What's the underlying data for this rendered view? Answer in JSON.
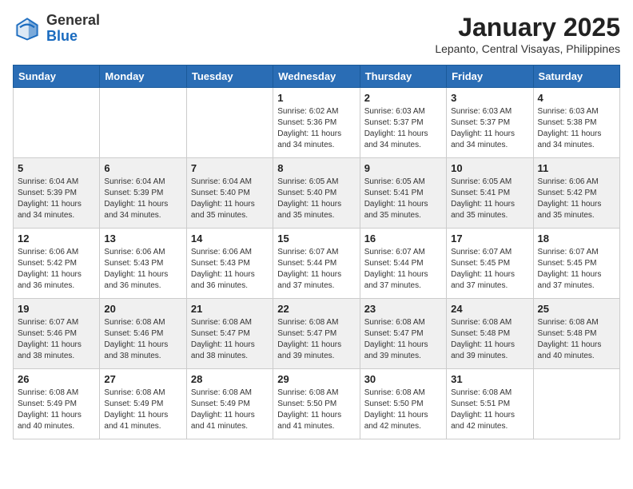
{
  "header": {
    "logo": {
      "general": "General",
      "blue": "Blue"
    },
    "title": "January 2025",
    "location": "Lepanto, Central Visayas, Philippines"
  },
  "weekdays": [
    "Sunday",
    "Monday",
    "Tuesday",
    "Wednesday",
    "Thursday",
    "Friday",
    "Saturday"
  ],
  "weeks": [
    [
      {
        "day": "",
        "info": ""
      },
      {
        "day": "",
        "info": ""
      },
      {
        "day": "",
        "info": ""
      },
      {
        "day": "1",
        "info": "Sunrise: 6:02 AM\nSunset: 5:36 PM\nDaylight: 11 hours\nand 34 minutes."
      },
      {
        "day": "2",
        "info": "Sunrise: 6:03 AM\nSunset: 5:37 PM\nDaylight: 11 hours\nand 34 minutes."
      },
      {
        "day": "3",
        "info": "Sunrise: 6:03 AM\nSunset: 5:37 PM\nDaylight: 11 hours\nand 34 minutes."
      },
      {
        "day": "4",
        "info": "Sunrise: 6:03 AM\nSunset: 5:38 PM\nDaylight: 11 hours\nand 34 minutes."
      }
    ],
    [
      {
        "day": "5",
        "info": "Sunrise: 6:04 AM\nSunset: 5:39 PM\nDaylight: 11 hours\nand 34 minutes."
      },
      {
        "day": "6",
        "info": "Sunrise: 6:04 AM\nSunset: 5:39 PM\nDaylight: 11 hours\nand 34 minutes."
      },
      {
        "day": "7",
        "info": "Sunrise: 6:04 AM\nSunset: 5:40 PM\nDaylight: 11 hours\nand 35 minutes."
      },
      {
        "day": "8",
        "info": "Sunrise: 6:05 AM\nSunset: 5:40 PM\nDaylight: 11 hours\nand 35 minutes."
      },
      {
        "day": "9",
        "info": "Sunrise: 6:05 AM\nSunset: 5:41 PM\nDaylight: 11 hours\nand 35 minutes."
      },
      {
        "day": "10",
        "info": "Sunrise: 6:05 AM\nSunset: 5:41 PM\nDaylight: 11 hours\nand 35 minutes."
      },
      {
        "day": "11",
        "info": "Sunrise: 6:06 AM\nSunset: 5:42 PM\nDaylight: 11 hours\nand 35 minutes."
      }
    ],
    [
      {
        "day": "12",
        "info": "Sunrise: 6:06 AM\nSunset: 5:42 PM\nDaylight: 11 hours\nand 36 minutes."
      },
      {
        "day": "13",
        "info": "Sunrise: 6:06 AM\nSunset: 5:43 PM\nDaylight: 11 hours\nand 36 minutes."
      },
      {
        "day": "14",
        "info": "Sunrise: 6:06 AM\nSunset: 5:43 PM\nDaylight: 11 hours\nand 36 minutes."
      },
      {
        "day": "15",
        "info": "Sunrise: 6:07 AM\nSunset: 5:44 PM\nDaylight: 11 hours\nand 37 minutes."
      },
      {
        "day": "16",
        "info": "Sunrise: 6:07 AM\nSunset: 5:44 PM\nDaylight: 11 hours\nand 37 minutes."
      },
      {
        "day": "17",
        "info": "Sunrise: 6:07 AM\nSunset: 5:45 PM\nDaylight: 11 hours\nand 37 minutes."
      },
      {
        "day": "18",
        "info": "Sunrise: 6:07 AM\nSunset: 5:45 PM\nDaylight: 11 hours\nand 37 minutes."
      }
    ],
    [
      {
        "day": "19",
        "info": "Sunrise: 6:07 AM\nSunset: 5:46 PM\nDaylight: 11 hours\nand 38 minutes."
      },
      {
        "day": "20",
        "info": "Sunrise: 6:08 AM\nSunset: 5:46 PM\nDaylight: 11 hours\nand 38 minutes."
      },
      {
        "day": "21",
        "info": "Sunrise: 6:08 AM\nSunset: 5:47 PM\nDaylight: 11 hours\nand 38 minutes."
      },
      {
        "day": "22",
        "info": "Sunrise: 6:08 AM\nSunset: 5:47 PM\nDaylight: 11 hours\nand 39 minutes."
      },
      {
        "day": "23",
        "info": "Sunrise: 6:08 AM\nSunset: 5:47 PM\nDaylight: 11 hours\nand 39 minutes."
      },
      {
        "day": "24",
        "info": "Sunrise: 6:08 AM\nSunset: 5:48 PM\nDaylight: 11 hours\nand 39 minutes."
      },
      {
        "day": "25",
        "info": "Sunrise: 6:08 AM\nSunset: 5:48 PM\nDaylight: 11 hours\nand 40 minutes."
      }
    ],
    [
      {
        "day": "26",
        "info": "Sunrise: 6:08 AM\nSunset: 5:49 PM\nDaylight: 11 hours\nand 40 minutes."
      },
      {
        "day": "27",
        "info": "Sunrise: 6:08 AM\nSunset: 5:49 PM\nDaylight: 11 hours\nand 41 minutes."
      },
      {
        "day": "28",
        "info": "Sunrise: 6:08 AM\nSunset: 5:49 PM\nDaylight: 11 hours\nand 41 minutes."
      },
      {
        "day": "29",
        "info": "Sunrise: 6:08 AM\nSunset: 5:50 PM\nDaylight: 11 hours\nand 41 minutes."
      },
      {
        "day": "30",
        "info": "Sunrise: 6:08 AM\nSunset: 5:50 PM\nDaylight: 11 hours\nand 42 minutes."
      },
      {
        "day": "31",
        "info": "Sunrise: 6:08 AM\nSunset: 5:51 PM\nDaylight: 11 hours\nand 42 minutes."
      },
      {
        "day": "",
        "info": ""
      }
    ]
  ]
}
